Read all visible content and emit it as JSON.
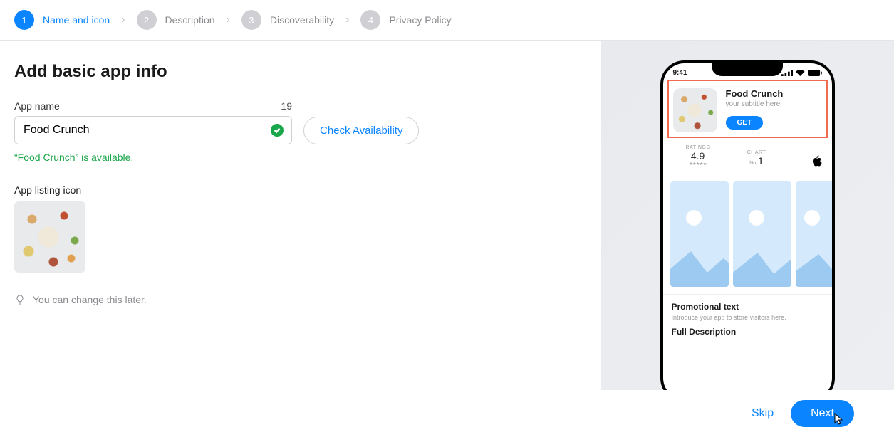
{
  "steps": [
    {
      "num": "1",
      "label": "Name and icon",
      "active": true
    },
    {
      "num": "2",
      "label": "Description",
      "active": false
    },
    {
      "num": "3",
      "label": "Discoverability",
      "active": false
    },
    {
      "num": "4",
      "label": "Privacy Policy",
      "active": false
    }
  ],
  "pageTitle": "Add basic app info",
  "appName": {
    "label": "App name",
    "value": "Food Crunch",
    "remaining": "19",
    "availabilityMsg": "“Food Crunch” is available."
  },
  "checkAvailabilityLabel": "Check Availability",
  "iconLabel": "App listing icon",
  "hint": "You can change this later.",
  "preview": {
    "time": "9:41",
    "title": "Food Crunch",
    "subtitle": "your subtitle here",
    "getLabel": "GET",
    "ratingsLabel": "RATINGS",
    "ratingsVal": "4.9",
    "stars": "★★★★★",
    "chartLabel": "CHART",
    "chartNoLabel": "No.",
    "chartNoVal": "1",
    "promoTitle": "Promotional text",
    "promoText": "Introduce your app to store visitors here.",
    "fullDescLabel": "Full Description"
  },
  "footer": {
    "skip": "Skip",
    "next": "Next"
  }
}
